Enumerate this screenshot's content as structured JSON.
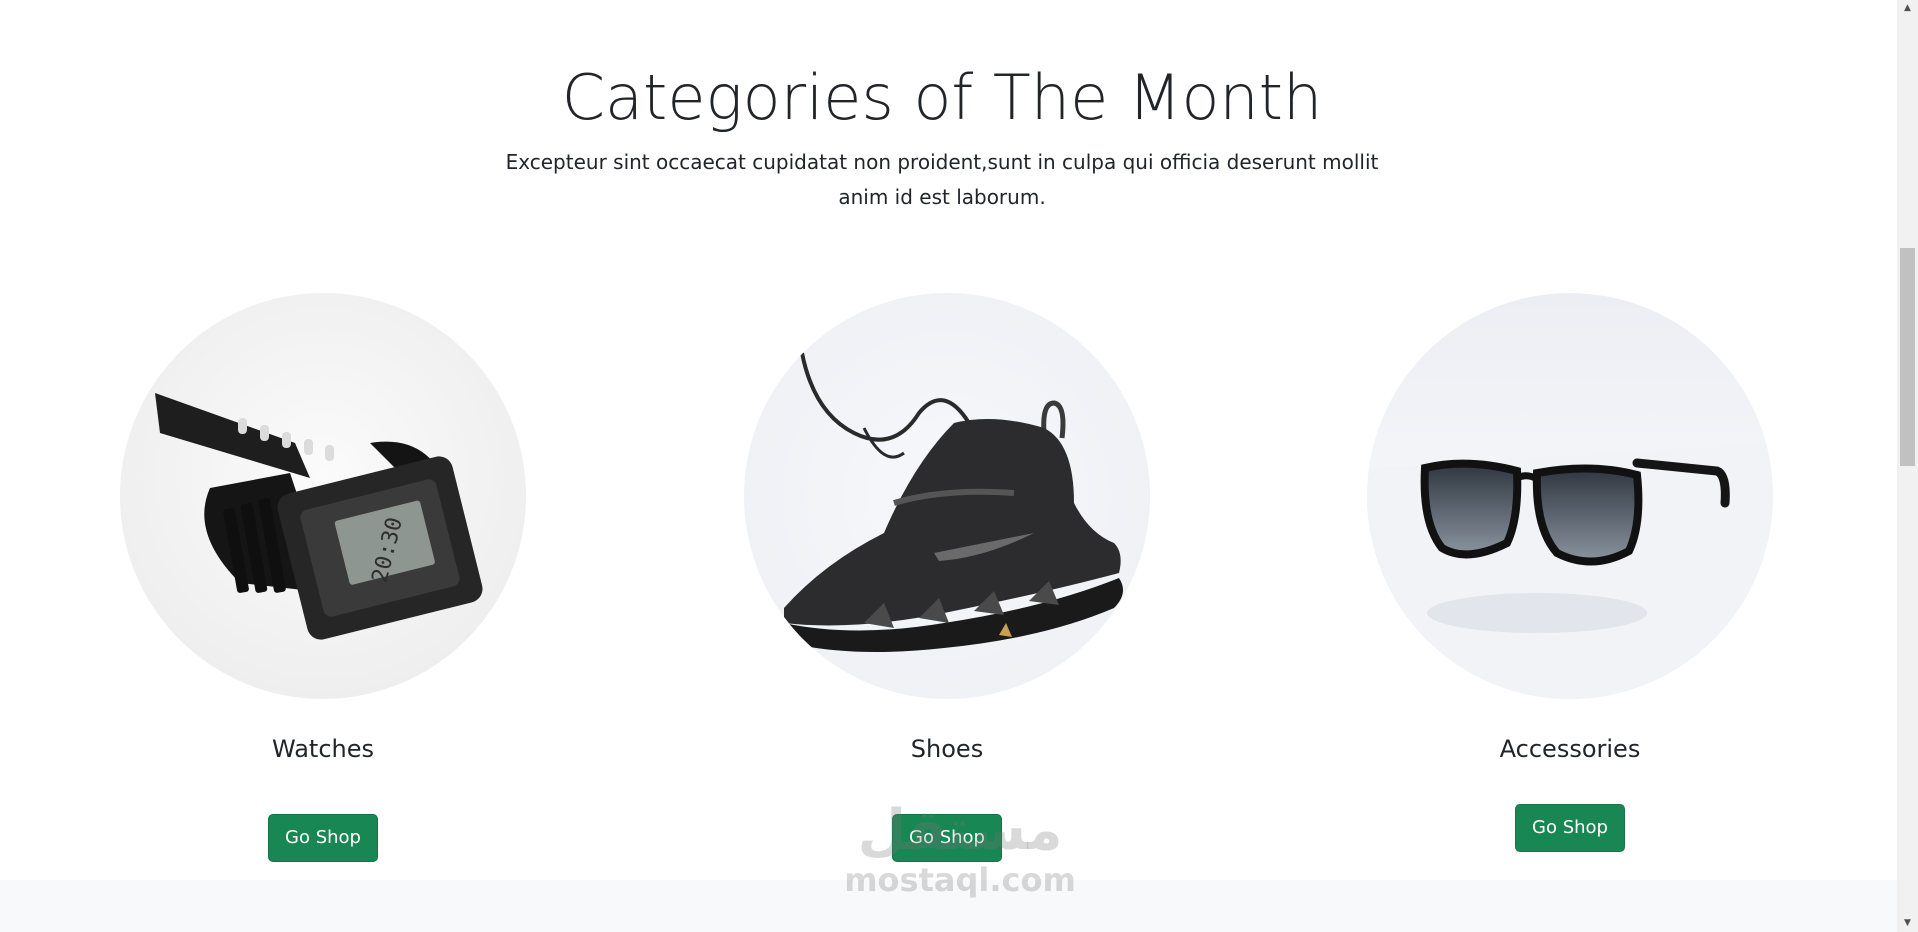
{
  "section": {
    "title": "Categories of The Month",
    "subtitle": "Excepteur sint occaecat cupidatat non proident,sunt in culpa qui officia deserunt mollit anim id est laborum."
  },
  "categories": [
    {
      "name": "Watches",
      "button_label": "Go Shop",
      "image_icon": "wristwatch-image"
    },
    {
      "name": "Shoes",
      "button_label": "Go Shop",
      "image_icon": "sneaker-image"
    },
    {
      "name": "Accessories",
      "button_label": "Go Shop",
      "image_icon": "sunglasses-image"
    }
  ],
  "watermark": {
    "arabic": "مستقل",
    "latin": "mostaql.com"
  },
  "colors": {
    "button_bg": "#198754",
    "text": "#212529",
    "footer_bg": "#f8f9fa"
  }
}
